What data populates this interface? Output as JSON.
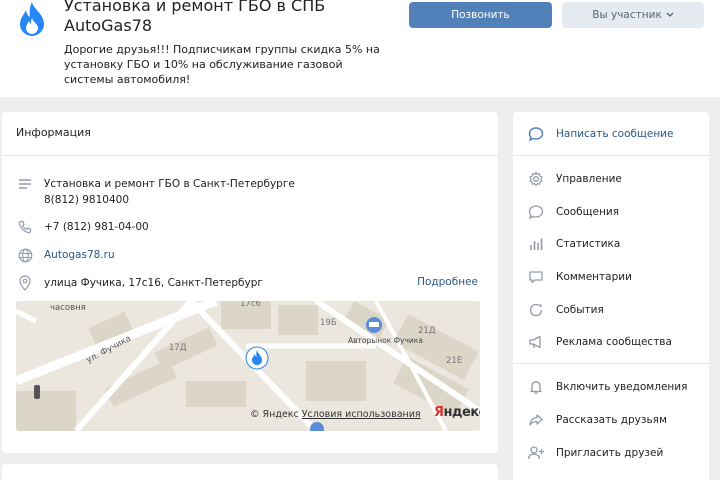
{
  "group": {
    "title": "Установка и ремонт ГБО в СПБ AutoGas78",
    "description": "Дорогие друзья!!! Подписчикам группы скидка 5% на установку ГБО и 10% на обслуживание газовой системы автомобиля!"
  },
  "header": {
    "call_label": "Позвонить",
    "member_label": "Вы участник"
  },
  "info": {
    "heading": "Информация",
    "about_line1": "Установка и ремонт ГБО в Санкт-Петербурге",
    "about_line2": "8(812) 9810400",
    "phone": "+7 (812) 981-04-00",
    "website": "Autogas78.ru",
    "address": "улица Фучика, 17с16, Санкт-Петербург",
    "more_label": "Подробнее"
  },
  "map": {
    "labels": [
      "часовня",
      "ул. Фучика",
      "17с6",
      "19Б",
      "17Д",
      "21Д",
      "21Е",
      "Авторынок Фучика"
    ],
    "attribution": "© Яндекс",
    "terms": "Условия использования",
    "brand_y": "Я",
    "brand_rest": "ндекс"
  },
  "menu": {
    "items": [
      {
        "label": "Написать сообщение",
        "icon": "message-icon"
      },
      {
        "label": "Управление",
        "icon": "gear-icon"
      },
      {
        "label": "Сообщения",
        "icon": "chat-icon"
      },
      {
        "label": "Статистика",
        "icon": "stats-icon"
      },
      {
        "label": "Комментарии",
        "icon": "comment-icon"
      },
      {
        "label": "События",
        "icon": "events-icon"
      },
      {
        "label": "Реклама сообщества",
        "icon": "megaphone-icon"
      },
      {
        "label": "Включить уведомления",
        "icon": "bell-icon"
      },
      {
        "label": "Рассказать друзьям",
        "icon": "share-icon"
      },
      {
        "label": "Пригласить друзей",
        "icon": "add-user-icon"
      }
    ]
  },
  "colors": {
    "accent": "#5181b8",
    "link": "#2a5885",
    "background": "#edeef0"
  }
}
